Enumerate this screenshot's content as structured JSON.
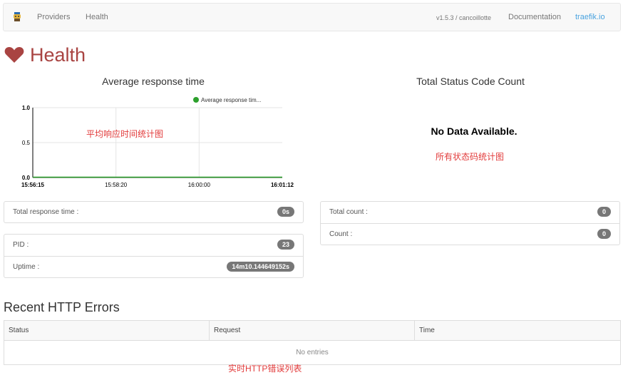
{
  "nav": {
    "providers": "Providers",
    "health": "Health",
    "version": "v1.5.3 / cancoillotte",
    "documentation": "Documentation",
    "brand_link": "traefik.io"
  },
  "page": {
    "title": "Health",
    "title_color": "#a94442"
  },
  "response_chart": {
    "heading": "Average response time",
    "annotation": "平均响应时间统计图"
  },
  "status_chart": {
    "heading": "Total Status Code Count",
    "no_data": "No Data Available.",
    "annotation": "所有状态码统计图"
  },
  "chart_data": {
    "type": "line",
    "series": [
      {
        "name": "Average response tim...",
        "color": "#2ca02c",
        "x": [
          "15:56:15",
          "15:58:20",
          "16:00:00",
          "16:01:12"
        ],
        "values": [
          0,
          0,
          0,
          0
        ]
      }
    ],
    "x_ticks": [
      "15:56:15",
      "15:58:20",
      "16:00:00",
      "16:01:12"
    ],
    "y_ticks": [
      "0.0",
      "0.5",
      "1.0"
    ],
    "ylim": [
      0,
      1
    ],
    "grid": true,
    "legend": "top-right"
  },
  "response_panel": {
    "total_label": "Total response time :",
    "total_value": "0s"
  },
  "process_panel": {
    "pid_label": "PID :",
    "pid_value": "23",
    "uptime_label": "Uptime :",
    "uptime_value": "14m10.144649152s"
  },
  "count_panel": {
    "total_count_label": "Total count :",
    "total_count_value": "0",
    "count_label": "Count :",
    "count_value": "0"
  },
  "errors": {
    "title": "Recent HTTP Errors",
    "columns": [
      "Status",
      "Request",
      "Time"
    ],
    "empty": "No entries",
    "annotation": "实时HTTP错误列表"
  }
}
